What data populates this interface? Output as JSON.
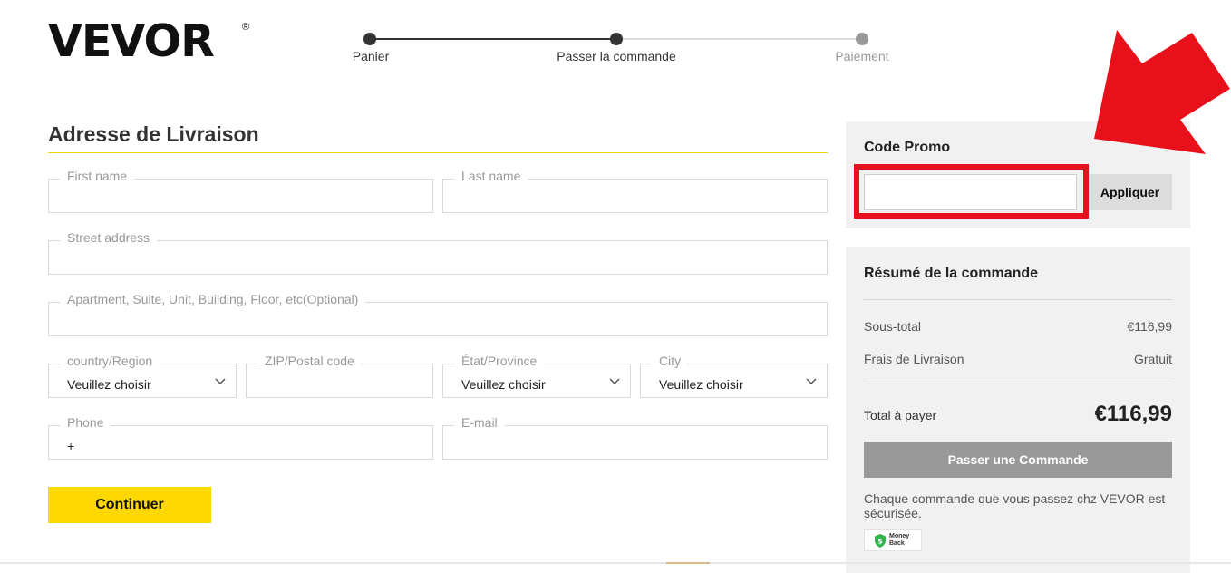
{
  "brand": {
    "logo_text": "VEVOR",
    "registered": "®"
  },
  "steps": [
    {
      "label": "Panier",
      "state": "done"
    },
    {
      "label": "Passer la commande",
      "state": "current"
    },
    {
      "label": "Paiement",
      "state": "todo"
    }
  ],
  "shipping": {
    "title": "Adresse de Livraison",
    "first_name": {
      "label": "First name",
      "value": ""
    },
    "last_name": {
      "label": "Last name",
      "value": ""
    },
    "street": {
      "label": "Street address",
      "value": ""
    },
    "apartment": {
      "label": "Apartment, Suite, Unit, Building, Floor, etc(Optional)",
      "value": ""
    },
    "country": {
      "label": "country/Region",
      "value": "Veuillez choisir"
    },
    "zip": {
      "label": "ZIP/Postal code",
      "value": ""
    },
    "state": {
      "label": "État/Province",
      "value": "Veuillez choisir"
    },
    "city": {
      "label": "City",
      "value": "Veuillez choisir"
    },
    "phone": {
      "label": "Phone",
      "value": "+"
    },
    "email": {
      "label": "E-mail",
      "value": ""
    },
    "continue_label": "Continuer"
  },
  "promo": {
    "title": "Code Promo",
    "input_value": "",
    "apply_label": "Appliquer"
  },
  "summary": {
    "title": "Résumé de la commande",
    "subtotal_label": "Sous-total",
    "subtotal_value": "€116,99",
    "shipping_label": "Frais de Livraison",
    "shipping_value": "Gratuit",
    "total_label": "Total à payer",
    "total_value": "€116,99",
    "order_button": "Passer une Commande",
    "secure_note": "Chaque commande que vous passez chz VEVOR est sécurisée.",
    "badge_line1": "Money",
    "badge_line2": "Back"
  },
  "colors": {
    "accent_yellow": "#ffd800",
    "annotation_red": "#e8101a",
    "panel_gray": "#f1f1f1",
    "step_done": "#333333",
    "step_todo": "#999999",
    "money_back_green": "#2fb34a"
  },
  "icons": [
    "chevron-down-icon",
    "arrow-annotation-icon",
    "money-back-shield-icon"
  ]
}
